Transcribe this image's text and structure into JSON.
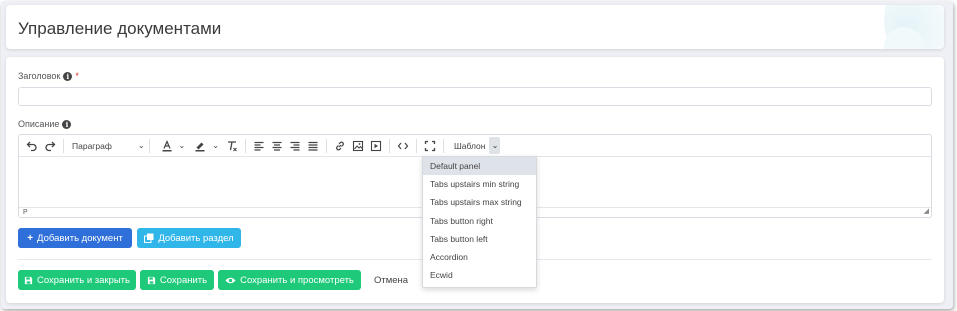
{
  "header": {
    "title": "Управление документами"
  },
  "form": {
    "title_label": "Заголовок",
    "required_mark": "*",
    "title_value": "",
    "description_label": "Описание"
  },
  "editor": {
    "paragraph_label": "Параграф",
    "template_label": "Шаблон",
    "status_path": "P",
    "template_options": [
      "Default panel",
      "Tabs upstairs min string",
      "Tabs upstairs max string",
      "Tabs button right",
      "Tabs button left",
      "Accordion",
      "Ecwid"
    ],
    "selected_option_index": 0
  },
  "buttons": {
    "add_document": "Добавить документ",
    "add_section": "Добавить раздел",
    "save_and_close": "Сохранить и закрыть",
    "save": "Сохранить",
    "save_and_view": "Сохранить и просмотреть",
    "cancel": "Отмена"
  },
  "colors": {
    "blue": "#2f6fd9",
    "cyan": "#31b6e9",
    "green": "#1ec97a",
    "required": "#e0372f"
  }
}
